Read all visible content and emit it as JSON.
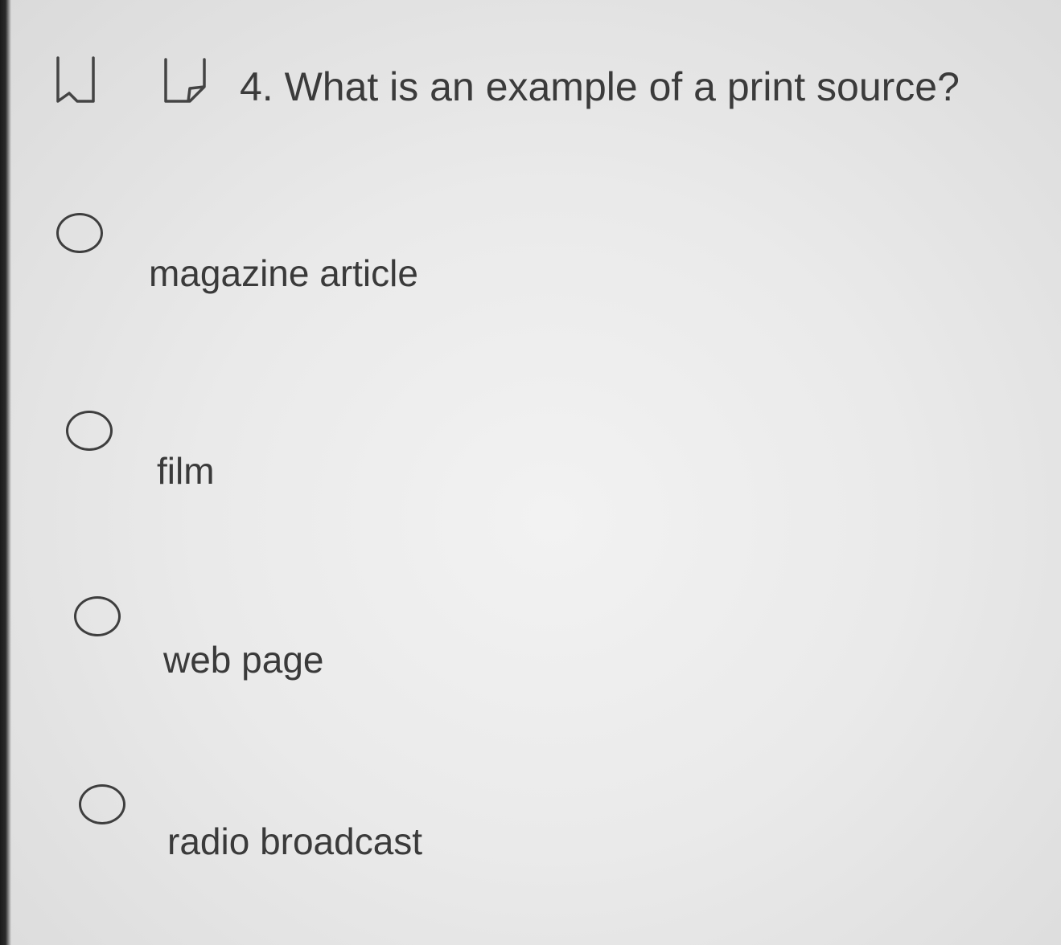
{
  "question": {
    "number_and_text": "4. What is an example of a print source?"
  },
  "toolbar": {
    "bookmark_icon": "bookmark-icon",
    "annotate_icon": "annotate-icon"
  },
  "options": [
    {
      "label": "magazine article"
    },
    {
      "label": "film"
    },
    {
      "label": "web page"
    },
    {
      "label": "radio broadcast"
    }
  ]
}
